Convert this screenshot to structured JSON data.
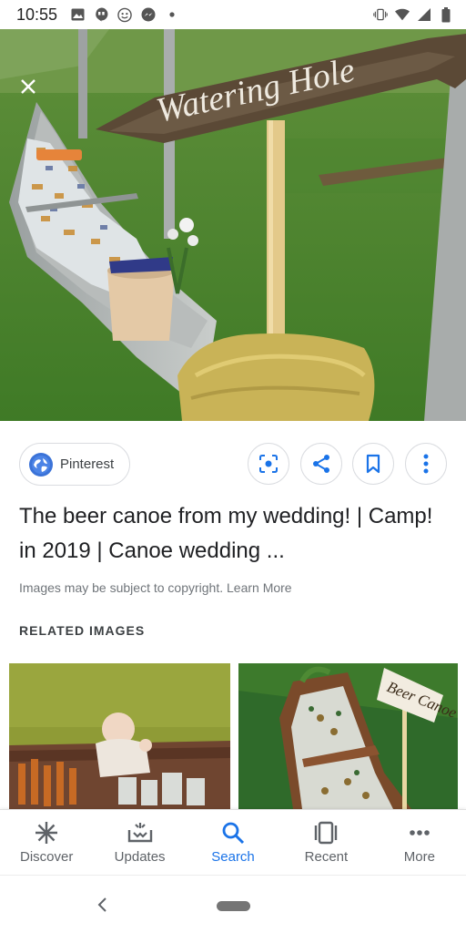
{
  "status_bar": {
    "time": "10:55"
  },
  "source": {
    "name": "Pinterest"
  },
  "result": {
    "title": "The beer canoe from my wedding! | Camp! in 2019 | Canoe wedding ...",
    "copyright_note": "Images may be subject to copyright. Learn More"
  },
  "hero_image": {
    "sign_text": "Watering Hole"
  },
  "related": {
    "heading": "RELATED IMAGES",
    "right_sign_text": "Beer Canoe"
  },
  "bottom_nav": {
    "items": [
      {
        "label": "Discover",
        "icon": "asterisk-icon"
      },
      {
        "label": "Updates",
        "icon": "updates-tray-icon"
      },
      {
        "label": "Search",
        "icon": "search-icon"
      },
      {
        "label": "Recent",
        "icon": "recent-cards-icon"
      },
      {
        "label": "More",
        "icon": "more-dots-icon"
      }
    ],
    "active_index": 2
  },
  "colors": {
    "accent": "#1a73e8",
    "text_primary": "#202124",
    "text_secondary": "#70757a"
  }
}
